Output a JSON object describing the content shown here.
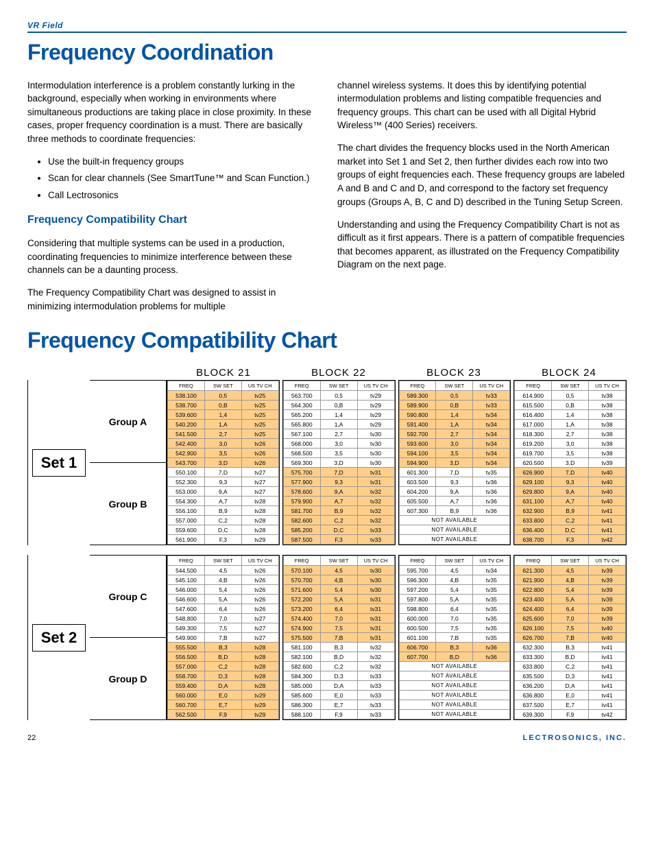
{
  "header_label": "VR Field",
  "title1": "Frequency Coordination",
  "intro_left_p1": "Intermodulation interference is a problem constantly lurking in the background, especially when working in environments where simultaneous productions are taking place in close proximity.  In these cases, proper frequency coordination is a must.  There are basically three methods to coordinate frequencies:",
  "bullets": [
    "Use the built-in frequency groups",
    "Scan for clear channels (See SmartTune™ and Scan Function.)",
    "Call Lectrosonics"
  ],
  "sub1": "Frequency Compatibility Chart",
  "left_p2": "Considering that multiple systems can be used in a production, coordinating frequencies to minimize interference between these channels can be a daunting process.",
  "left_p3": "The Frequency Compatibility Chart was designed to assist in minimizing intermodulation problems for multiple",
  "right_p1": "channel wireless systems.  It does this by identifying potential intermodulation problems and listing compatible  frequencies and frequency groups.  This chart can be used with all Digital Hybrid Wireless™ (400 Series) receivers.",
  "right_p2": "The chart divides the frequency blocks used in the North American market into Set 1 and Set 2, then further divides each row into two groups of eight frequencies each.  These frequency groups are labeled A and B and C and D, and correspond to the factory set frequency groups (Groups A, B, C and D) described in the Tuning Setup Screen.",
  "right_p3": "Understanding and using the Frequency Compatibility Chart is not as difficult as it first appears.  There is a pattern of compatible frequencies that becomes apparent, as illustrated on the Frequency Compatibility Diagram on the next page.",
  "title2": "Frequency Compatibility Chart",
  "block_labels": [
    "BLOCK 21",
    "BLOCK 22",
    "BLOCK 23",
    "BLOCK 24"
  ],
  "col_heads": [
    "FREQ",
    "SW SET",
    "US TV CH"
  ],
  "set1_label": "Set 1",
  "set2_label": "Set 2",
  "groupA": "Group A",
  "groupB": "Group B",
  "groupC": "Group C",
  "groupD": "Group D",
  "na_text": "NOT AVAILABLE",
  "set1": {
    "block21": [
      {
        "f": "538.100",
        "s": "0,5",
        "t": "tv25",
        "hl": true
      },
      {
        "f": "538.700",
        "s": "0,B",
        "t": "tv25",
        "hl": true
      },
      {
        "f": "539.600",
        "s": "1,4",
        "t": "tv25",
        "hl": true
      },
      {
        "f": "540.200",
        "s": "1,A",
        "t": "tv25",
        "hl": true
      },
      {
        "f": "541.500",
        "s": "2,7",
        "t": "tv25",
        "hl": true
      },
      {
        "f": "542.400",
        "s": "3,0",
        "t": "tv26",
        "hl": true
      },
      {
        "f": "542.900",
        "s": "3,5",
        "t": "tv26",
        "hl": true
      },
      {
        "f": "543.700",
        "s": "3,D",
        "t": "tv26",
        "hl": true
      },
      {
        "f": "550.100",
        "s": "7,D",
        "t": "tv27"
      },
      {
        "f": "552.300",
        "s": "9,3",
        "t": "tv27"
      },
      {
        "f": "553.000",
        "s": "9,A",
        "t": "tv27"
      },
      {
        "f": "554.300",
        "s": "A,7",
        "t": "tv28"
      },
      {
        "f": "556.100",
        "s": "B,9",
        "t": "tv28"
      },
      {
        "f": "557.000",
        "s": "C,2",
        "t": "tv28"
      },
      {
        "f": "559.600",
        "s": "D,C",
        "t": "tv28"
      },
      {
        "f": "561.900",
        "s": "F,3",
        "t": "tv29"
      }
    ],
    "block22": [
      {
        "f": "563.700",
        "s": "0,5",
        "t": "tv29"
      },
      {
        "f": "564.300",
        "s": "0,B",
        "t": "tv29"
      },
      {
        "f": "565.200",
        "s": "1,4",
        "t": "tv29"
      },
      {
        "f": "565.800",
        "s": "1,A",
        "t": "tv29"
      },
      {
        "f": "567.100",
        "s": "2,7",
        "t": "tv30"
      },
      {
        "f": "568.000",
        "s": "3,0",
        "t": "tv30"
      },
      {
        "f": "568.500",
        "s": "3,5",
        "t": "tv30"
      },
      {
        "f": "569.300",
        "s": "3,D",
        "t": "tv30"
      },
      {
        "f": "575.700",
        "s": "7,D",
        "t": "tv31",
        "hl": true
      },
      {
        "f": "577.900",
        "s": "9,3",
        "t": "tv31",
        "hl": true
      },
      {
        "f": "578.600",
        "s": "9,A",
        "t": "tv32",
        "hl": true
      },
      {
        "f": "579.900",
        "s": "A,7",
        "t": "tv32",
        "hl": true
      },
      {
        "f": "581.700",
        "s": "B,9",
        "t": "tv32",
        "hl": true
      },
      {
        "f": "582.600",
        "s": "C,2",
        "t": "tv32",
        "hl": true
      },
      {
        "f": "585.200",
        "s": "D,C",
        "t": "tv33",
        "hl": true
      },
      {
        "f": "587.500",
        "s": "F,3",
        "t": "tv33",
        "hl": true
      }
    ],
    "block23": [
      {
        "f": "589.300",
        "s": "0,5",
        "t": "tv33",
        "hl": true
      },
      {
        "f": "589.900",
        "s": "0,B",
        "t": "tv33",
        "hl": true
      },
      {
        "f": "590.800",
        "s": "1,4",
        "t": "tv34",
        "hl": true
      },
      {
        "f": "591.400",
        "s": "1,A",
        "t": "tv34",
        "hl": true
      },
      {
        "f": "592.700",
        "s": "2,7",
        "t": "tv34",
        "hl": true
      },
      {
        "f": "593.600",
        "s": "3,0",
        "t": "tv34",
        "hl": true
      },
      {
        "f": "594.100",
        "s": "3,5",
        "t": "tv34",
        "hl": true
      },
      {
        "f": "594.900",
        "s": "3,D",
        "t": "tv34",
        "hl": true
      },
      {
        "f": "601.300",
        "s": "7,D",
        "t": "tv35"
      },
      {
        "f": "603.500",
        "s": "9,3",
        "t": "tv36"
      },
      {
        "f": "604.200",
        "s": "9,A",
        "t": "tv36"
      },
      {
        "f": "605.500",
        "s": "A,7",
        "t": "tv36"
      },
      {
        "f": "607.300",
        "s": "B,9",
        "t": "tv36"
      },
      {
        "na": true
      },
      {
        "na": true
      },
      {
        "na": true
      }
    ],
    "block24": [
      {
        "f": "614.900",
        "s": "0,5",
        "t": "tv38"
      },
      {
        "f": "615.500",
        "s": "0,B",
        "t": "tv38"
      },
      {
        "f": "616.400",
        "s": "1,4",
        "t": "tv38"
      },
      {
        "f": "617.000",
        "s": "1,A",
        "t": "tv38"
      },
      {
        "f": "618.300",
        "s": "2,7",
        "t": "tv38"
      },
      {
        "f": "619.200",
        "s": "3,0",
        "t": "tv38"
      },
      {
        "f": "619.700",
        "s": "3,5",
        "t": "tv38"
      },
      {
        "f": "620.500",
        "s": "3,D",
        "t": "tv39"
      },
      {
        "f": "626.900",
        "s": "7,D",
        "t": "tv40",
        "hl": true
      },
      {
        "f": "629.100",
        "s": "9,3",
        "t": "tv40",
        "hl": true
      },
      {
        "f": "629.800",
        "s": "9,A",
        "t": "tv40",
        "hl": true
      },
      {
        "f": "631.100",
        "s": "A,7",
        "t": "tv40",
        "hl": true
      },
      {
        "f": "632.900",
        "s": "B,9",
        "t": "tv41",
        "hl": true
      },
      {
        "f": "633.800",
        "s": "C,2",
        "t": "tv41",
        "hl": true
      },
      {
        "f": "636.400",
        "s": "D,C",
        "t": "tv41",
        "hl": true
      },
      {
        "f": "638.700",
        "s": "F,3",
        "t": "tv42",
        "hl": true
      }
    ]
  },
  "set2": {
    "block21": [
      {
        "f": "544.500",
        "s": "4,5",
        "t": "tv26"
      },
      {
        "f": "545.100",
        "s": "4,B",
        "t": "tv26"
      },
      {
        "f": "546.000",
        "s": "5,4",
        "t": "tv26"
      },
      {
        "f": "546.600",
        "s": "5,A",
        "t": "tv26"
      },
      {
        "f": "547.600",
        "s": "6,4",
        "t": "tv26"
      },
      {
        "f": "548.800",
        "s": "7,0",
        "t": "tv27"
      },
      {
        "f": "549.300",
        "s": "7,5",
        "t": "tv27"
      },
      {
        "f": "549.900",
        "s": "7,B",
        "t": "tv27"
      },
      {
        "f": "555.500",
        "s": "B,3",
        "t": "tv28",
        "hl": true
      },
      {
        "f": "556.500",
        "s": "B,D",
        "t": "tv28",
        "hl": true
      },
      {
        "f": "557.000",
        "s": "C,2",
        "t": "tv28",
        "hl": true
      },
      {
        "f": "558.700",
        "s": "D,3",
        "t": "tv28",
        "hl": true
      },
      {
        "f": "559.400",
        "s": "D,A",
        "t": "tv28",
        "hl": true
      },
      {
        "f": "560.000",
        "s": "E,0",
        "t": "tv29",
        "hl": true
      },
      {
        "f": "560.700",
        "s": "E,7",
        "t": "tv29",
        "hl": true
      },
      {
        "f": "562.500",
        "s": "F,9",
        "t": "tv29",
        "hl": true
      }
    ],
    "block22": [
      {
        "f": "570.100",
        "s": "4,5",
        "t": "tv30",
        "hl": true
      },
      {
        "f": "570.700",
        "s": "4,B",
        "t": "tv30",
        "hl": true
      },
      {
        "f": "571.600",
        "s": "5,4",
        "t": "tv30",
        "hl": true
      },
      {
        "f": "572.200",
        "s": "5,A",
        "t": "tv31",
        "hl": true
      },
      {
        "f": "573.200",
        "s": "6,4",
        "t": "tv31",
        "hl": true
      },
      {
        "f": "574.400",
        "s": "7,0",
        "t": "tv31",
        "hl": true
      },
      {
        "f": "574.900",
        "s": "7,5",
        "t": "tv31",
        "hl": true
      },
      {
        "f": "575.500",
        "s": "7,B",
        "t": "tv31",
        "hl": true
      },
      {
        "f": "581.100",
        "s": "B,3",
        "t": "tv32"
      },
      {
        "f": "582.100",
        "s": "B,D",
        "t": "tv32"
      },
      {
        "f": "582.600",
        "s": "C,2",
        "t": "tv32"
      },
      {
        "f": "584.300",
        "s": "D,3",
        "t": "tv33"
      },
      {
        "f": "585.000",
        "s": "D,A",
        "t": "tv33"
      },
      {
        "f": "585.600",
        "s": "E,0",
        "t": "tv33"
      },
      {
        "f": "586.300",
        "s": "E,7",
        "t": "tv33"
      },
      {
        "f": "588.100",
        "s": "F,9",
        "t": "tv33"
      }
    ],
    "block23": [
      {
        "f": "595.700",
        "s": "4,5",
        "t": "tv34"
      },
      {
        "f": "596.300",
        "s": "4,B",
        "t": "tv35"
      },
      {
        "f": "597.200",
        "s": "5,4",
        "t": "tv35"
      },
      {
        "f": "597.800",
        "s": "5,A",
        "t": "tv35"
      },
      {
        "f": "598.800",
        "s": "6,4",
        "t": "tv35"
      },
      {
        "f": "600.000",
        "s": "7,0",
        "t": "tv35"
      },
      {
        "f": "600.500",
        "s": "7,5",
        "t": "tv35"
      },
      {
        "f": "601.100",
        "s": "7,B",
        "t": "tv35"
      },
      {
        "f": "606.700",
        "s": "B,3",
        "t": "tv36",
        "hl": true
      },
      {
        "f": "607.700",
        "s": "B,D",
        "t": "tv36",
        "hl": true
      },
      {
        "na": true
      },
      {
        "na": true
      },
      {
        "na": true
      },
      {
        "na": true
      },
      {
        "na": true
      },
      {
        "na": true
      }
    ],
    "block24": [
      {
        "f": "621.300",
        "s": "4,5",
        "t": "tv39",
        "hl": true
      },
      {
        "f": "621.900",
        "s": "4,B",
        "t": "tv39",
        "hl": true
      },
      {
        "f": "622.800",
        "s": "5,4",
        "t": "tv39",
        "hl": true
      },
      {
        "f": "623.400",
        "s": "5,A",
        "t": "tv39",
        "hl": true
      },
      {
        "f": "624.400",
        "s": "6,4",
        "t": "tv39",
        "hl": true
      },
      {
        "f": "625.600",
        "s": "7,0",
        "t": "tv39",
        "hl": true
      },
      {
        "f": "626.100",
        "s": "7,5",
        "t": "tv40",
        "hl": true
      },
      {
        "f": "626.700",
        "s": "7,B",
        "t": "tv40",
        "hl": true
      },
      {
        "f": "632.300",
        "s": "B,3",
        "t": "tv41"
      },
      {
        "f": "633.300",
        "s": "B,D",
        "t": "tv41"
      },
      {
        "f": "633.800",
        "s": "C,2",
        "t": "tv41"
      },
      {
        "f": "635.500",
        "s": "D,3",
        "t": "tv41"
      },
      {
        "f": "636.200",
        "s": "D,A",
        "t": "tv41"
      },
      {
        "f": "636.800",
        "s": "E,0",
        "t": "tv41"
      },
      {
        "f": "637.500",
        "s": "E,7",
        "t": "tv41"
      },
      {
        "f": "639.300",
        "s": "F,9",
        "t": "tv42"
      }
    ]
  },
  "page_num": "22",
  "footer_right": "LECTROSONICS, INC."
}
